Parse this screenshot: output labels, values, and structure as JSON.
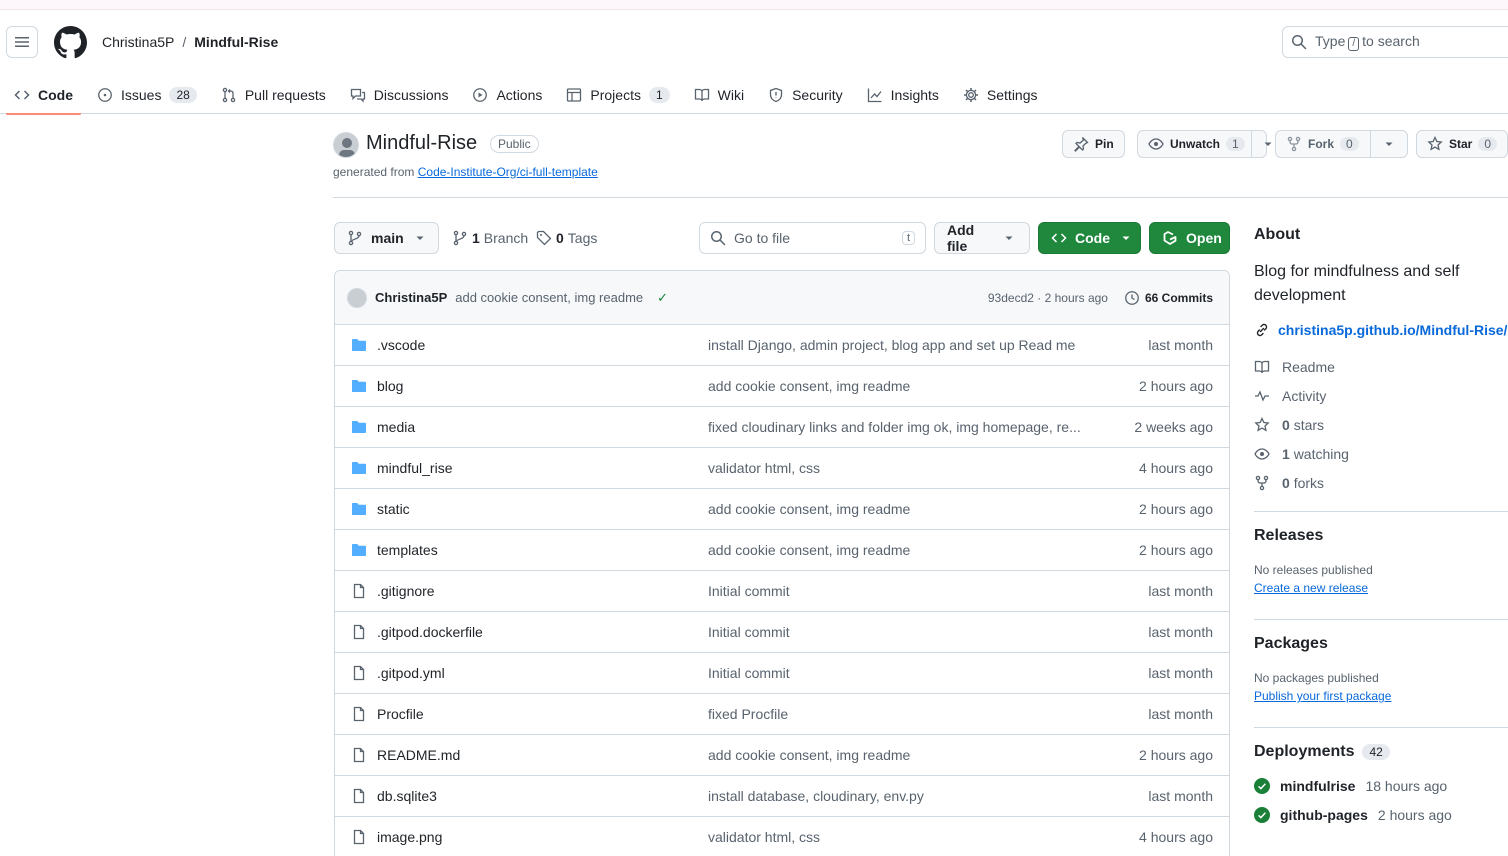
{
  "header": {
    "owner": "Christina5P",
    "separator": "/",
    "repo": "Mindful-Rise",
    "search_prefix": "Type",
    "search_key": "/",
    "search_suffix": "to search"
  },
  "tabs": [
    {
      "label": "Code",
      "icon": "code-icon",
      "count": null
    },
    {
      "label": "Issues",
      "icon": "issue-icon",
      "count": "28"
    },
    {
      "label": "Pull requests",
      "icon": "pull-request-icon",
      "count": null
    },
    {
      "label": "Discussions",
      "icon": "discussion-icon",
      "count": null
    },
    {
      "label": "Actions",
      "icon": "play-icon",
      "count": null
    },
    {
      "label": "Projects",
      "icon": "table-icon",
      "count": "1"
    },
    {
      "label": "Wiki",
      "icon": "book-icon",
      "count": null
    },
    {
      "label": "Security",
      "icon": "shield-icon",
      "count": null
    },
    {
      "label": "Insights",
      "icon": "graph-icon",
      "count": null
    },
    {
      "label": "Settings",
      "icon": "gear-icon",
      "count": null
    }
  ],
  "repo": {
    "name": "Mindful-Rise",
    "visibility": "Public",
    "generated_prefix": "generated from",
    "generated_link": "Code-Institute-Org/ci-full-template"
  },
  "actions": {
    "pin": "Pin",
    "unwatch": "Unwatch",
    "watch_count": "1",
    "fork": "Fork",
    "fork_count": "0",
    "star": "Star",
    "star_count": "0"
  },
  "toolbar": {
    "branch": "main",
    "branches_count": "1",
    "branches_label": "Branch",
    "tags_count": "0",
    "tags_label": "Tags",
    "go_to_file": "Go to file",
    "go_to_file_key": "t",
    "add_file": "Add file",
    "code": "Code",
    "open": "Open"
  },
  "latest_commit": {
    "author": "Christina5P",
    "message": "add cookie consent, img readme",
    "status": "✓",
    "sha_time": "93decd2 · 2 hours ago",
    "commits_count": "66 Commits"
  },
  "files": [
    {
      "name": ".vscode",
      "type": "dir",
      "message": "install Django, admin project, blog app and set up Read me",
      "date": "last month"
    },
    {
      "name": "blog",
      "type": "dir",
      "message": "add cookie consent, img readme",
      "date": "2 hours ago"
    },
    {
      "name": "media",
      "type": "dir",
      "message": "fixed cloudinary links and folder img ok, img homepage, re...",
      "date": "2 weeks ago"
    },
    {
      "name": "mindful_rise",
      "type": "dir",
      "message": "validator html, css",
      "date": "4 hours ago"
    },
    {
      "name": "static",
      "type": "dir",
      "message": "add cookie consent, img readme",
      "date": "2 hours ago"
    },
    {
      "name": "templates",
      "type": "dir",
      "message": "add cookie consent, img readme",
      "date": "2 hours ago"
    },
    {
      "name": ".gitignore",
      "type": "file",
      "message": "Initial commit",
      "date": "last month"
    },
    {
      "name": ".gitpod.dockerfile",
      "type": "file",
      "message": "Initial commit",
      "date": "last month"
    },
    {
      "name": ".gitpod.yml",
      "type": "file",
      "message": "Initial commit",
      "date": "last month"
    },
    {
      "name": "Procfile",
      "type": "file",
      "message": "fixed Procfile",
      "date": "last month"
    },
    {
      "name": "README.md",
      "type": "file",
      "message": "add cookie consent, img readme",
      "date": "2 hours ago"
    },
    {
      "name": "db.sqlite3",
      "type": "file",
      "message": "install database, cloudinary, env.py",
      "date": "last month"
    },
    {
      "name": "image.png",
      "type": "file",
      "message": "validator html, css",
      "date": "4 hours ago"
    }
  ],
  "about": {
    "title": "About",
    "description": "Blog for mindfulness and self development",
    "website": "christina5p.github.io/Mindful-Rise/",
    "readme": "Readme",
    "activity": "Activity",
    "stars_count": "0",
    "stars_label": "stars",
    "watching_count": "1",
    "watching_label": "watching",
    "forks_count": "0",
    "forks_label": "forks"
  },
  "releases": {
    "title": "Releases",
    "empty": "No releases published",
    "create": "Create a new release"
  },
  "packages": {
    "title": "Packages",
    "empty": "No packages published",
    "publish": "Publish your first package"
  },
  "deployments": {
    "title": "Deployments",
    "count": "42",
    "items": [
      {
        "env": "mindfulrise",
        "when": "18 hours ago"
      },
      {
        "env": "github-pages",
        "when": "2 hours ago"
      }
    ]
  }
}
